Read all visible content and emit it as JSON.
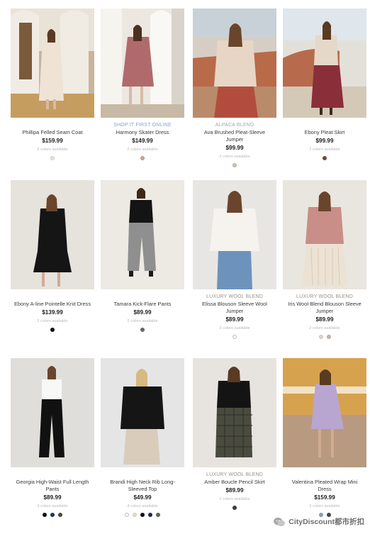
{
  "products": [
    {
      "tag": "",
      "name": "Phillipa Felled Seam Coat",
      "price": "$159.99",
      "avail": "2 colors available",
      "swatches": [
        "#e8dfd2"
      ]
    },
    {
      "tag": "SHOP IT FIRST ONLINE",
      "name": "Harmony Skater Dress",
      "price": "$149.99",
      "avail": "2 colors available",
      "swatches": [
        "#c9a39a"
      ]
    },
    {
      "tag": "ALPACA BLEND",
      "name": "Ava Brushed Pleat-Sleeve Jumper",
      "price": "$99.99",
      "avail": "2 colors available",
      "swatches": [
        "#cdbfb2"
      ]
    },
    {
      "tag": "",
      "name": "Ebony Pleat Skirt",
      "price": "$99.99",
      "avail": "2 colors available",
      "swatches": [
        "#6b4c40"
      ]
    },
    {
      "tag": "",
      "name": "Ebony A-line Pointelle Knit Dress",
      "price": "$139.99",
      "avail": "2 colors available",
      "swatches": [
        "#111111"
      ]
    },
    {
      "tag": "",
      "name": "Tamara Kick-Flare Pants",
      "price": "$89.99",
      "avail": "2 colors available",
      "swatches": [
        "#6b6b6b"
      ]
    },
    {
      "tag": "LUXURY WOOL BLEND",
      "name": "Elissa Blouson Sleeve Wool Jumper",
      "price": "$89.99",
      "avail": "2 colors available",
      "swatches": [
        "outline"
      ]
    },
    {
      "tag": "LUXURY WOOL BLEND",
      "name": "Iris Wool-Blend Blouson Sleeve Jumper",
      "price": "$89.99",
      "avail": "2 colors available",
      "swatches": [
        "#dcd6cc",
        "#c2b8a4"
      ]
    },
    {
      "tag": "",
      "name": "Georgia High-Waist Full Length Pants",
      "price": "$89.99",
      "avail": "3 colors available",
      "swatches": [
        "#111111",
        "#23375a",
        "#4b4b3c"
      ]
    },
    {
      "tag": "",
      "name": "Brandi High Neck Rib Long-Sleeved Top",
      "price": "$49.99",
      "avail": "4 colors available",
      "swatches": [
        "outline",
        "#e7dcc6",
        "#111111",
        "#1f2d44",
        "#5a6b5e"
      ]
    },
    {
      "tag": "LUXURY WOOL BLEND",
      "name": "Amber Boucle Pencil Skirt",
      "price": "$89.99",
      "avail": "2 colors available",
      "swatches": [
        "#3e3a37"
      ]
    },
    {
      "tag": "",
      "name": "Valentina Pleated Wrap Mini Dress",
      "price": "$159.99",
      "avail": "2 colors available",
      "swatches": [
        "#8fa1b7",
        "#3b4a5e"
      ]
    }
  ],
  "watermark": "CityDiscount都市折扣"
}
